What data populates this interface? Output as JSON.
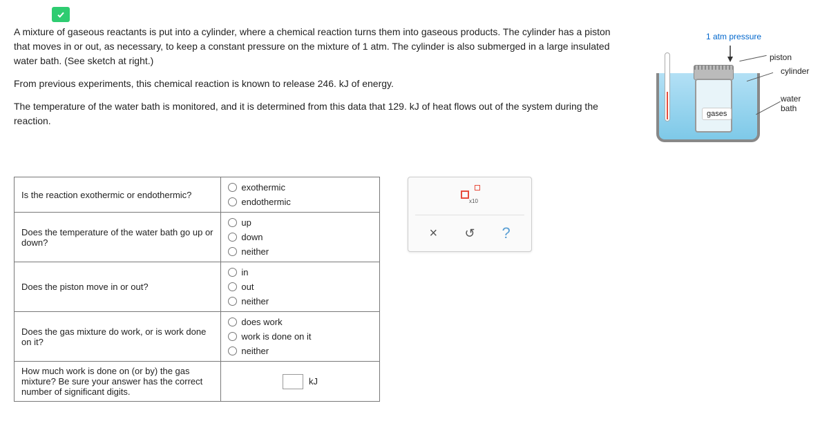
{
  "problem": {
    "paragraph1": "A mixture of gaseous reactants is put into a cylinder, where a chemical reaction turns them into gaseous products. The cylinder has a piston that moves in or out, as necessary, to keep a constant pressure on the mixture of 1 atm. The cylinder is also submerged in a large insulated water bath. (See sketch at right.)",
    "paragraph2": "From previous experiments, this chemical reaction is known to release 246. kJ of energy.",
    "paragraph3": "The temperature of the water bath is monitored, and it is determined from this data that 129. kJ of heat flows out of the system during the reaction."
  },
  "diagram": {
    "pressure_label": "1 atm pressure",
    "piston_label": "piston",
    "cylinder_label": "cylinder",
    "water_bath_label": "water bath",
    "gases_label": "gases"
  },
  "questions": [
    {
      "prompt": "Is the reaction exothermic or endothermic?",
      "options": [
        "exothermic",
        "endothermic"
      ]
    },
    {
      "prompt": "Does the temperature of the water bath go up or down?",
      "options": [
        "up",
        "down",
        "neither"
      ]
    },
    {
      "prompt": "Does the piston move in or out?",
      "options": [
        "in",
        "out",
        "neither"
      ]
    },
    {
      "prompt": "Does the gas mixture do work, or is work done on it?",
      "options": [
        "does work",
        "work is done on it",
        "neither"
      ]
    },
    {
      "prompt": "How much work is done on (or by) the gas mixture? Be sure your answer has the correct number of significant digits.",
      "unit": "kJ"
    }
  ],
  "controls": {
    "sci_notation": "x10",
    "clear": "×",
    "reset": "↺",
    "help": "?"
  }
}
